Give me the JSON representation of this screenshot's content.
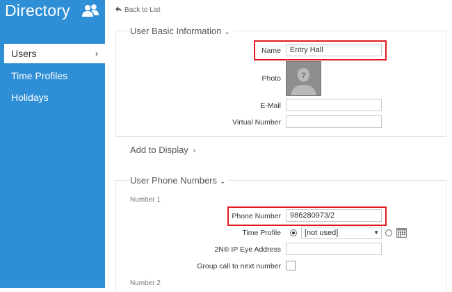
{
  "sidebar": {
    "title": "Directory",
    "items": [
      {
        "label": "Users",
        "chevron": "›"
      },
      {
        "label": "Time Profiles"
      },
      {
        "label": "Holidays"
      }
    ]
  },
  "back_label": "Back to List",
  "basic_section": {
    "title": "User Basic Information",
    "chevron": "⌄",
    "name_label": "Name",
    "name_value": "Entry Hall",
    "photo_label": "Photo",
    "email_label": "E-Mail",
    "email_value": "",
    "virtual_number_label": "Virtual Number",
    "virtual_number_value": ""
  },
  "add_display": {
    "label": "Add to Display",
    "chevron": "›"
  },
  "phone_section": {
    "title": "User Phone Numbers",
    "chevron": "⌄",
    "number1_label": "Number 1",
    "phone_number_label": "Phone Number",
    "phone_number_value": "986280973/2",
    "time_profile_label": "Time Profile",
    "time_profile_value": "[not used]",
    "eye_address_label": "2N® IP Eye Address",
    "eye_address_value": "",
    "group_call_label": "Group call to next number",
    "group_call_checked": false,
    "number2_label": "Number 2"
  },
  "colors": {
    "sidebar": "#2f8fd6",
    "highlight": "#e0191f"
  },
  "icons": [
    "users-icon",
    "back-arrow-icon",
    "chevron-right-icon",
    "chevron-down-icon",
    "person-placeholder-icon",
    "calendar-icon",
    "dropdown-caret-icon"
  ]
}
